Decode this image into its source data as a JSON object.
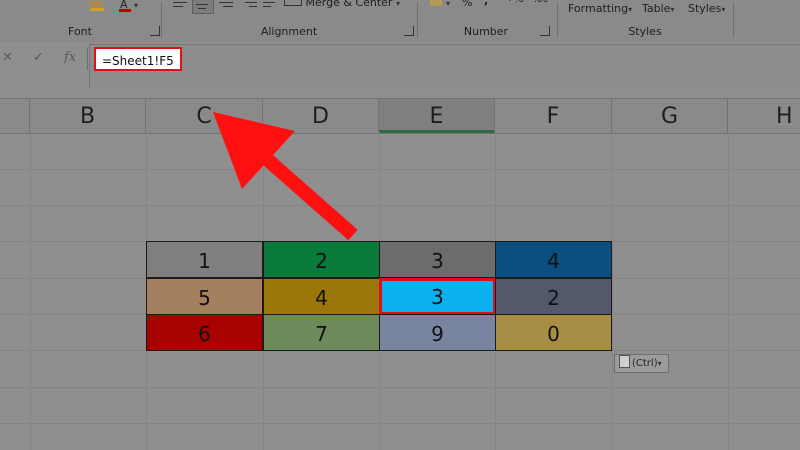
{
  "ribbon": {
    "groups": {
      "font": "Font",
      "alignment": "Alignment",
      "number": "Number",
      "styles": "Styles"
    },
    "merge_center": "Merge & Center",
    "percent": "%",
    "comma": ",",
    "styles_buttons": {
      "formatting": "Formatting",
      "table": "Table",
      "cell_styles": "Styles"
    }
  },
  "formula_bar": {
    "cancel": "✕",
    "enter": "✓",
    "fx": "fx",
    "formula": "=Sheet1!F5"
  },
  "columns": [
    "B",
    "C",
    "D",
    "E",
    "F",
    "G",
    "H"
  ],
  "active_column": "E",
  "table": [
    [
      {
        "v": "1",
        "c": "#7f7f7f"
      },
      {
        "v": "2",
        "c": "#0a7a3a"
      },
      {
        "v": "3",
        "c": "#6d6b6b"
      },
      {
        "v": "4",
        "c": "#0b4f80"
      }
    ],
    [
      {
        "v": "5",
        "c": "#a5805f"
      },
      {
        "v": "4",
        "c": "#9a7708"
      },
      {
        "v": "3",
        "c": "#0cb0ee"
      },
      {
        "v": "2",
        "c": "#52596a"
      }
    ],
    [
      {
        "v": "6",
        "c": "#a90000"
      },
      {
        "v": "7",
        "c": "#6d8a5a"
      },
      {
        "v": "9",
        "c": "#7985a0"
      },
      {
        "v": "0",
        "c": "#a88e44"
      }
    ]
  ],
  "selected_cell": {
    "row": 1,
    "col": 2
  },
  "paste_options": "(Ctrl)",
  "colors": {
    "highlight": "#e0101a",
    "annotation_arrow": "#ff1010"
  }
}
